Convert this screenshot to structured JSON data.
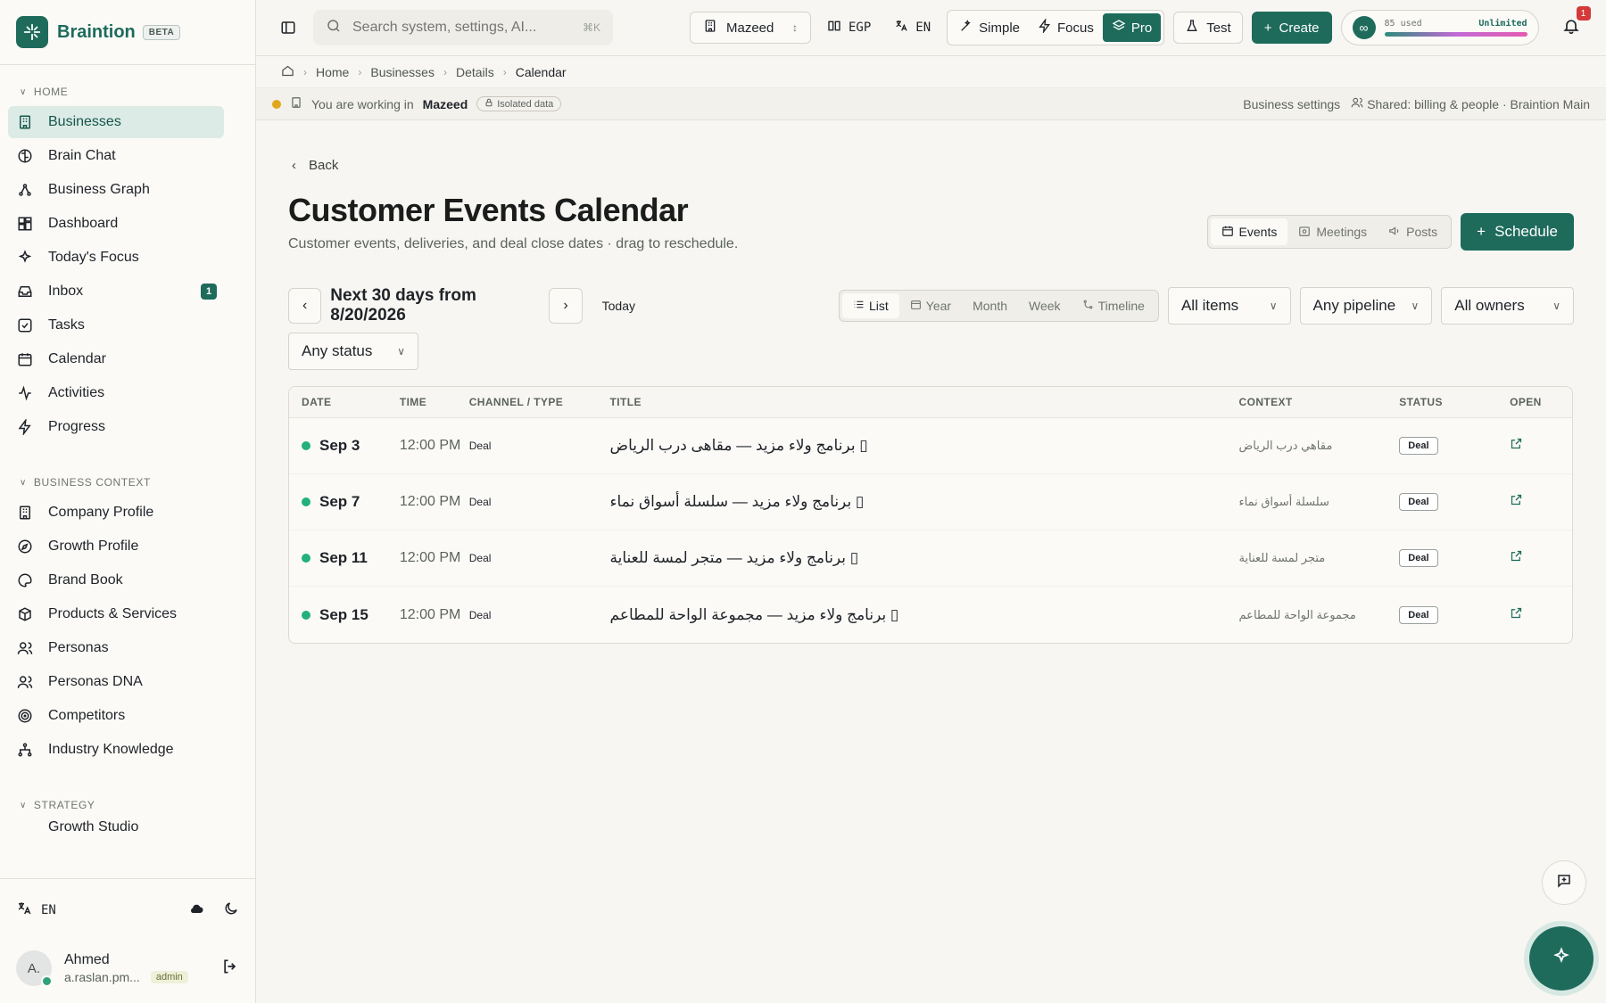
{
  "brand": {
    "name": "Braintion",
    "badge": "BETA"
  },
  "sidebar": {
    "sections": [
      {
        "title": "HOME"
      },
      {
        "title": "BUSINESS CONTEXT"
      },
      {
        "title": "STRATEGY"
      }
    ],
    "home_items": [
      {
        "label": "Businesses",
        "icon": "building-icon",
        "active": true
      },
      {
        "label": "Brain Chat",
        "icon": "brain-icon"
      },
      {
        "label": "Business Graph",
        "icon": "graph-icon"
      },
      {
        "label": "Dashboard",
        "icon": "dashboard-icon"
      },
      {
        "label": "Today's Focus",
        "icon": "sparkle-icon"
      },
      {
        "label": "Inbox",
        "icon": "inbox-icon",
        "badge": "1"
      },
      {
        "label": "Tasks",
        "icon": "checkbox-icon"
      },
      {
        "label": "Calendar",
        "icon": "calendar-icon"
      },
      {
        "label": "Activities",
        "icon": "activity-icon"
      },
      {
        "label": "Progress",
        "icon": "bolt-icon"
      }
    ],
    "context_items": [
      {
        "label": "Company Profile",
        "icon": "building-icon"
      },
      {
        "label": "Growth Profile",
        "icon": "compass-icon"
      },
      {
        "label": "Brand Book",
        "icon": "palette-icon"
      },
      {
        "label": "Products & Services",
        "icon": "box-icon"
      },
      {
        "label": "Personas",
        "icon": "users-icon"
      },
      {
        "label": "Personas DNA",
        "icon": "users-icon"
      },
      {
        "label": "Competitors",
        "icon": "target-icon"
      },
      {
        "label": "Industry Knowledge",
        "icon": "tree-icon"
      }
    ],
    "strategy_partial": "Growth Studio",
    "footer": {
      "language": "EN",
      "user_name": "Ahmed",
      "user_initials": "A.",
      "user_email": "a.raslan.pm...",
      "role": "admin"
    }
  },
  "topbar": {
    "search_placeholder": "Search system, settings, AI...",
    "search_shortcut": "⌘K",
    "workspace": "Mazeed",
    "currency": "EGP",
    "language": "EN",
    "modes": [
      {
        "label": "Simple",
        "active": false
      },
      {
        "label": "Focus",
        "active": false
      },
      {
        "label": "Pro",
        "active": true
      }
    ],
    "test_label": "Test",
    "create_label": "Create",
    "usage_used": "85 used",
    "usage_limit": "Unlimited",
    "notifications": "1"
  },
  "breadcrumb": [
    "Home",
    "Businesses",
    "Details",
    "Calendar"
  ],
  "context_bar": {
    "prefix": "You are working in",
    "workspace": "Mazeed",
    "isolated": "Isolated data",
    "settings_link": "Business settings",
    "shared": "Shared: billing & people · Braintion Main"
  },
  "page": {
    "back_label": "Back",
    "title": "Customer Events Calendar",
    "subtitle": "Customer events, deliveries, and deal close dates · drag to reschedule.",
    "view_tabs": [
      {
        "label": "Events",
        "active": true
      },
      {
        "label": "Meetings",
        "active": false
      },
      {
        "label": "Posts",
        "active": false
      }
    ],
    "schedule_label": "Schedule",
    "range_label": "Next 30 days from 8/20/2026",
    "today_label": "Today",
    "mode_tabs": [
      {
        "label": "List",
        "active": true
      },
      {
        "label": "Year",
        "active": false
      },
      {
        "label": "Month",
        "active": false
      },
      {
        "label": "Week",
        "active": false
      },
      {
        "label": "Timeline",
        "active": false
      }
    ],
    "filters": {
      "items": "All items",
      "pipeline": "Any pipeline",
      "owners": "All owners",
      "status": "Any status"
    }
  },
  "table": {
    "headers": {
      "date": "DATE",
      "time": "TIME",
      "type": "CHANNEL / TYPE",
      "title": "TITLE",
      "context": "CONTEXT",
      "status": "STATUS",
      "open": "OPEN"
    },
    "rows": [
      {
        "date": "Sep 3",
        "time": "12:00 PM",
        "type": "Deal",
        "title": "▯ برنامج ولاء مزيد — مقاهى درب الرياض",
        "context": "مقاهي درب الرياض",
        "status": "Deal"
      },
      {
        "date": "Sep 7",
        "time": "12:00 PM",
        "type": "Deal",
        "title": "▯ برنامج ولاء مزيد — سلسلة أسواق نماء",
        "context": "سلسلة أسواق نماء",
        "status": "Deal"
      },
      {
        "date": "Sep 11",
        "time": "12:00 PM",
        "type": "Deal",
        "title": "▯ برنامج ولاء مزيد — متجر لمسة للعناية",
        "context": "متجر لمسة للعناية",
        "status": "Deal"
      },
      {
        "date": "Sep 15",
        "time": "12:00 PM",
        "type": "Deal",
        "title": "▯ برنامج ولاء مزيد — مجموعة الواحة للمطاعم",
        "context": "مجموعة الواحة للمطاعم",
        "status": "Deal"
      }
    ]
  },
  "colors": {
    "accent": "#1e6b5c",
    "status_dot": "#22b07d",
    "warning_dot": "#e0a71c"
  }
}
